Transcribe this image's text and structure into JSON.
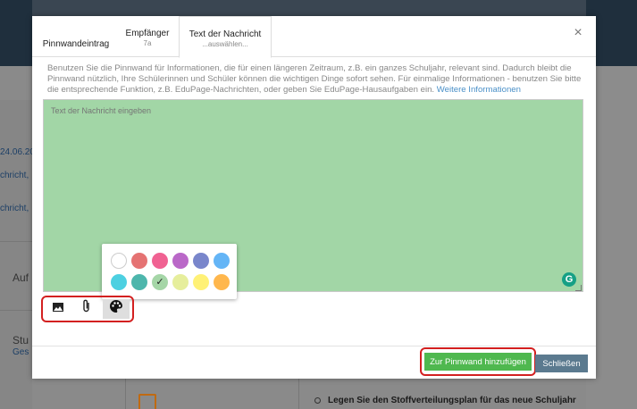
{
  "background": {
    "date_fragment": "24.06.20",
    "link_fragment_1": "chricht,",
    "link_fragment_2": "chricht,",
    "label_auf": "Auf",
    "label_stu": "Stu",
    "label_ges": "Ges",
    "bullet_text": "Legen Sie den Stoffverteilungsplan für das neue Schuljahr"
  },
  "modal": {
    "tabs": [
      {
        "label": "Pinnwandeintrag",
        "sub": ""
      },
      {
        "label": "Empfänger",
        "sub": "7a"
      },
      {
        "label": "Text der Nachricht",
        "sub": "...auswählen..."
      }
    ],
    "close_icon": "close-icon",
    "info_text": "Benutzen Sie die Pinnwand für Informationen, die für einen längeren Zeitraum, z.B. ein ganzes Schuljahr, relevant sind. Dadurch bleibt die Pinnwand nützlich, Ihre Schülerinnen und Schüler können die wichtigen Dinge sofort sehen. Für einmalige Informationen - benutzen Sie bitte die entsprechende Funktion, z.B. EduPage-Nachrichten, oder geben Sie EduPage-Hausaufgaben ein.",
    "info_link": "Weitere Informationen",
    "editor_placeholder": "Text der Nachricht eingeben",
    "editor_color": "#a2d6a6",
    "palette": [
      {
        "color": "#ffffff",
        "selected": false
      },
      {
        "color": "#e57373",
        "selected": false
      },
      {
        "color": "#f06292",
        "selected": false
      },
      {
        "color": "#ba68c8",
        "selected": false
      },
      {
        "color": "#7986cb",
        "selected": false
      },
      {
        "color": "#64b5f6",
        "selected": false
      },
      {
        "color": "#4dd0e1",
        "selected": false
      },
      {
        "color": "#4db6ac",
        "selected": false
      },
      {
        "color": "#a5d6a7",
        "selected": true
      },
      {
        "color": "#e6ee9c",
        "selected": false
      },
      {
        "color": "#fff176",
        "selected": false
      },
      {
        "color": "#ffb74d",
        "selected": false
      }
    ],
    "toolbar": [
      {
        "icon": "image-icon",
        "glyph": "▣"
      },
      {
        "icon": "paperclip-icon",
        "glyph": "⌀"
      },
      {
        "icon": "palette-icon",
        "glyph": "◕"
      }
    ],
    "add_button": "Zur Pinnwand hinzufügen",
    "close_button": "Schließen"
  }
}
